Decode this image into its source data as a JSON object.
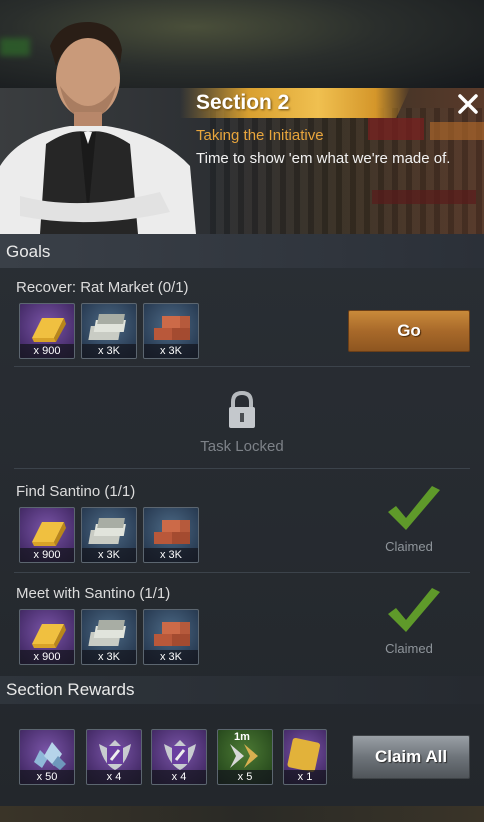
{
  "header": {
    "section_title": "Section 2",
    "subtitle": "Taking the Initiative",
    "description": "Time to show 'em what we're made of."
  },
  "goals": {
    "heading": "Goals",
    "items": [
      {
        "title": "Recover: Rat Market (0/1)",
        "action_label": "Go",
        "rewards": [
          {
            "icon": "gold-bar-icon",
            "qty": "x 900"
          },
          {
            "icon": "cash-stack-icon",
            "qty": "x 3K"
          },
          {
            "icon": "bricks-icon",
            "qty": "x 3K"
          }
        ]
      },
      {
        "locked_label": "Task Locked"
      },
      {
        "title": "Find Santino (1/1)",
        "status_label": "Claimed",
        "rewards": [
          {
            "icon": "gold-bar-icon",
            "qty": "x 900"
          },
          {
            "icon": "cash-stack-icon",
            "qty": "x 3K"
          },
          {
            "icon": "bricks-icon",
            "qty": "x 3K"
          }
        ]
      },
      {
        "title": "Meet with Santino (1/1)",
        "status_label": "Claimed",
        "rewards": [
          {
            "icon": "gold-bar-icon",
            "qty": "x 900"
          },
          {
            "icon": "cash-stack-icon",
            "qty": "x 3K"
          },
          {
            "icon": "bricks-icon",
            "qty": "x 3K"
          }
        ]
      }
    ]
  },
  "section_rewards": {
    "heading": "Section Rewards",
    "claim_all_label": "Claim All",
    "items": [
      {
        "icon": "diamond-pile-icon",
        "qty": "x 50"
      },
      {
        "icon": "wrench-badge-icon",
        "qty": "x 4"
      },
      {
        "icon": "wrench-badge-icon",
        "qty": "x 4"
      },
      {
        "icon": "speedup-1m-icon",
        "qty": "x 5",
        "badge": "1m"
      },
      {
        "icon": "gold-card-icon",
        "qty": "x 1"
      }
    ]
  },
  "colors": {
    "accent_gold": "#e8a53c",
    "go_button": "#b06f2c",
    "claimed_check": "#5f9a2a"
  }
}
